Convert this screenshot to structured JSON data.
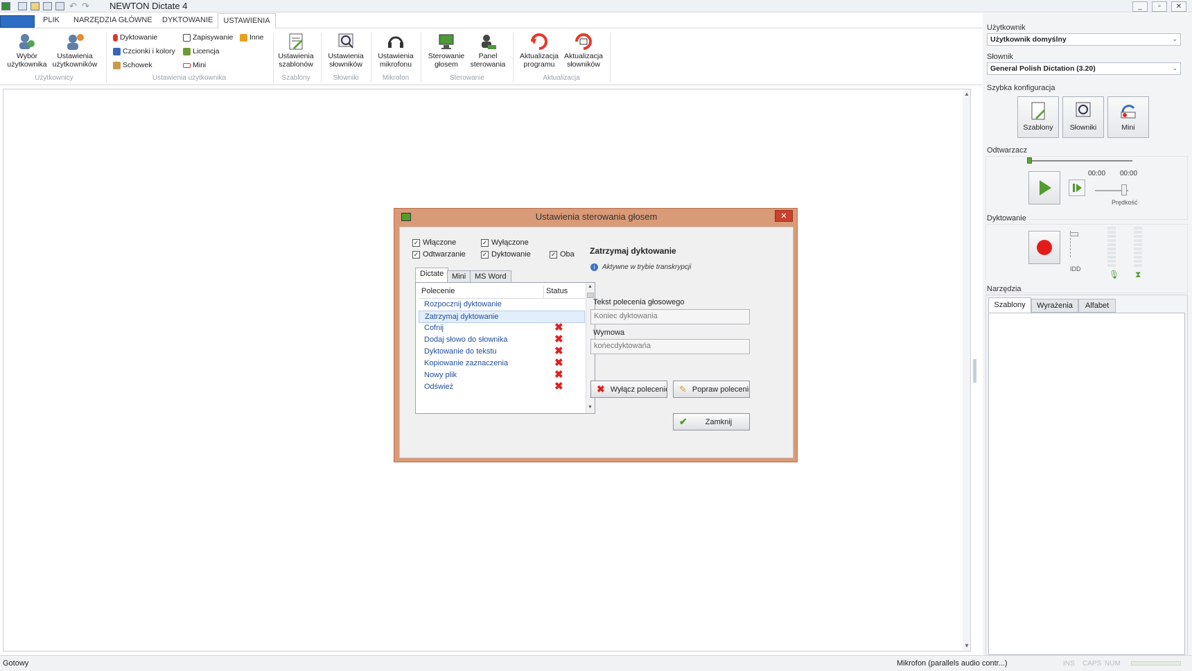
{
  "window": {
    "title": "NEWTON Dictate 4",
    "controls": [
      "_",
      "▫",
      "✕"
    ]
  },
  "menu": {
    "tabs": [
      "PLIK",
      "NARZĘDZIA GŁÓWNE",
      "DYKTOWANIE",
      "USTAWIENIA"
    ],
    "active": "USTAWIENIA"
  },
  "ribbon": {
    "wybor": "Wybór\nużytkownika",
    "ustaw_uzytk": "Ustawienia\nużytkowników",
    "grp_uzytkownicy": "Użytkownicy",
    "dyktowanie": "Dyktowanie",
    "czcionki": "Czcionki i kolory",
    "schowek": "Schowek",
    "zapisywanie": "Zapisywanie",
    "licencja": "Licencja",
    "mini": "Mini",
    "inne": "Inne",
    "grp_ustaw_uzytk": "Ustawienia użytkownika",
    "ustaw_szablonow": "Ustawienia\nszablonów",
    "grp_szablony": "Szablony",
    "ustaw_slownikow": "Ustawienia\nsłowników",
    "grp_slowniki": "Słowniki",
    "ustaw_mikrofonu": "Ustawienia\nmikrofonu",
    "grp_mikrofon": "Mikrofon",
    "sterowanie_glosem": "Sterowanie\ngłosem",
    "panel_sterowania": "Panel\nsterowania",
    "grp_sterowanie": "Sterowanie",
    "akt_programu": "Aktualizacja\nprogramu",
    "akt_slownikow": "Aktualizacja\nsłowników",
    "grp_aktualizacja": "Aktualizacja"
  },
  "status": {
    "left": "Gotowy",
    "mic": "Mikrofon (parallels audio contr...)",
    "ins": "INS",
    "caps": "CAPS",
    "num": "NUM"
  },
  "side": {
    "user_label": "Użytkownik",
    "user_value": "Użytkownik domyślny",
    "dict_label": "Słownik",
    "dict_value": "General Polish Dictation (3.20)",
    "quick_label": "Szybka konfiguracja",
    "quick_buttons": [
      "Szablony",
      "Słowniki",
      "Mini"
    ],
    "player_label": "Odtwarzacz",
    "time1": "00:00",
    "time2": "00:00",
    "speed": "Prędkość",
    "dict_panel_label": "Dyktowanie",
    "idd": "IDD",
    "tools_label": "Narzędzia",
    "tools_tabs": [
      "Szablony",
      "Wyrażenia",
      "Alfabet"
    ]
  },
  "dialog": {
    "title": "Ustawienia sterowania głosem",
    "checks": [
      "Włączone",
      "Wyłączone",
      "Odtwarzanie",
      "Dyktowanie",
      "Oba"
    ],
    "tabs": [
      "Dictate",
      "Mini",
      "MS Word"
    ],
    "col_command": "Polecenie",
    "col_status": "Status",
    "commands": [
      "Rozpocznij dyktowanie",
      "Zatrzymaj dyktowanie",
      "Cofnij",
      "Dodaj słowo do słownika",
      "Dyktowanie do tekstu",
      "Kopiowanie zaznaczenia",
      "Nowy plik",
      "Odśwież"
    ],
    "selected_title": "Zatrzymaj dyktowanie",
    "info": "Aktywne w trybie transkrypcji",
    "voice_label": "Tekst polecenia głosowego",
    "voice_value": "Koniec dyktowania",
    "pron_label": "Wymowa",
    "pron_value": "końecdyktowańa",
    "btn_disable": "Wyłącz polecenie",
    "btn_fix": "Popraw polecenie",
    "btn_close": "Zamknij"
  }
}
